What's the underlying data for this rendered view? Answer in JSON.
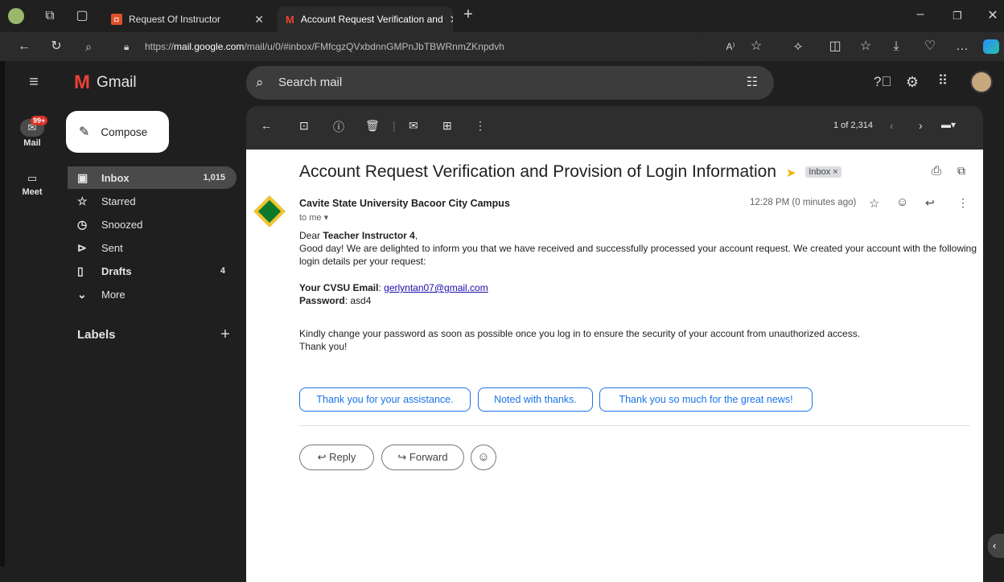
{
  "browser": {
    "tabs": [
      {
        "label": "Request Of Instructor"
      },
      {
        "label": "Account Request Verification and"
      }
    ],
    "url_prefix": "https://",
    "url_host": "mail.google.com",
    "url_path": "/mail/u/0/#inbox/FMfcgzQVxbdnnGMPnJbTBWRnmZKnpdvh",
    "reader_label": "A⁾"
  },
  "gmail": {
    "logo_text": "Gmail",
    "search_placeholder": "Search mail",
    "compose_label": "Compose",
    "rail": {
      "mail_label": "Mail",
      "mail_badge": "99+",
      "meet_label": "Meet"
    },
    "nav": [
      {
        "label": "Inbox",
        "count": "1,015"
      },
      {
        "label": "Starred",
        "count": ""
      },
      {
        "label": "Snoozed",
        "count": ""
      },
      {
        "label": "Sent",
        "count": ""
      },
      {
        "label": "Drafts",
        "count": "4"
      },
      {
        "label": "More",
        "count": ""
      }
    ],
    "labels_heading": "Labels",
    "pager": "1 of 2,314"
  },
  "email": {
    "subject": "Account Request Verification and Provision of Login Information",
    "label_chip": "Inbox ×",
    "sender": "Cavite State University Bacoor City Campus",
    "to": "to me",
    "time": "12:28 PM (0 minutes ago)",
    "greeting_prefix": "Dear ",
    "greeting_name": "Teacher Instructor 4",
    "greeting_suffix": ",",
    "para1": "Good day! We are delighted to inform you that we have received and successfully processed your account request. We created your account with the following login details per your request:",
    "email_label": "Your CVSU Email",
    "email_value": "gerlyntan07@gmail.com",
    "password_label": "Password",
    "password_value": "asd4",
    "para2": "Kindly change your password as soon as possible once you log in to ensure the security of your account from unauthorized access.",
    "closing": "Thank you!",
    "smart_replies": [
      "Thank you for your assistance.",
      "Noted with thanks.",
      "Thank you so much for the great news!"
    ],
    "reply_label": "Reply",
    "forward_label": "Forward"
  },
  "colors": {
    "accent": "#1a73e8",
    "gmail_red": "#ea4335",
    "badge": "#d93025"
  }
}
